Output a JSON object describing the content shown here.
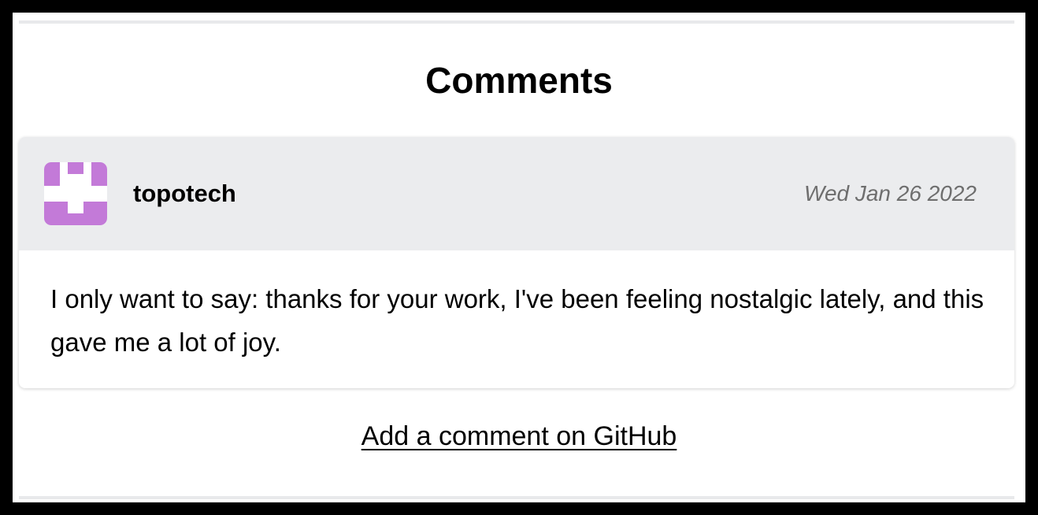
{
  "section": {
    "title": "Comments"
  },
  "comments": [
    {
      "author": "topotech",
      "date": "Wed Jan 26 2022",
      "body": "I only want to say: thanks for your work, I've been feeling nostalgic lately, and this gave me a lot of joy.",
      "avatar_icon": "identicon-avatar",
      "avatar_color": "#c37ad8"
    }
  ],
  "footer": {
    "add_comment_label": "Add a comment on GitHub"
  },
  "colors": {
    "background_outer": "#000000",
    "panel": "#ffffff",
    "card_header": "#ebecee",
    "date_text": "#6e6e6e"
  }
}
